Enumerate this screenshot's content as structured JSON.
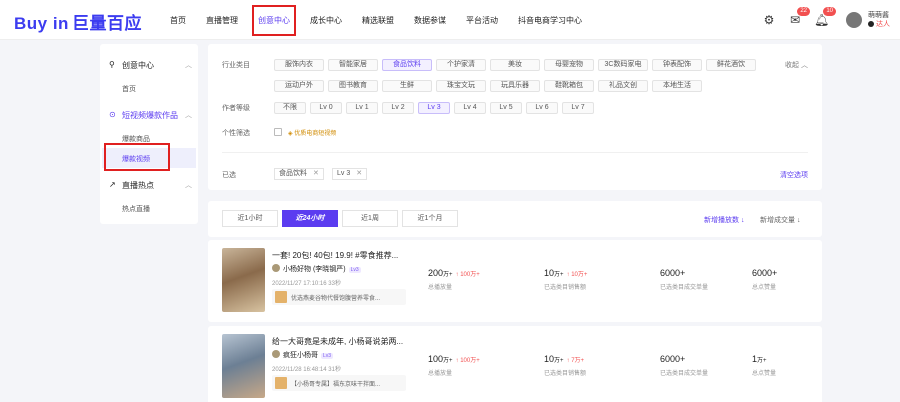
{
  "header": {
    "logo_en": "Buy in",
    "logo_cn": "巨量百应",
    "nav": [
      "首页",
      "直播管理",
      "创意中心",
      "成长中心",
      "精选联盟",
      "数据参谋",
      "平台活动",
      "抖音电商学习中心"
    ],
    "notif_msg_count": "22",
    "notif_bell_count": "10",
    "user_name": "萌萌酱",
    "user_tag": "达人"
  },
  "sidebar": {
    "group1": "创意中心",
    "group1_items": [
      "首页"
    ],
    "group2": "短视频爆款作品",
    "group2_items": [
      "爆款商品",
      "爆款视频"
    ],
    "group3": "直播热点",
    "group3_items": [
      "热点直播"
    ]
  },
  "filter": {
    "industry_label": "行业类目",
    "industry_row1": [
      "服饰内衣",
      "智能家居",
      "食品饮料",
      "个护家清",
      "美妆",
      "母婴宠物",
      "3C数码家电",
      "钟表配饰",
      "鲜花酒饮"
    ],
    "industry_row2": [
      "运动户外",
      "图书教育",
      "生鲜",
      "珠宝文玩",
      "玩具乐器",
      "鞋靴箱包",
      "礼品文创",
      "本地生活"
    ],
    "collapse": "收起",
    "level_label": "作者等级",
    "levels": [
      "不限",
      "Lv 0",
      "Lv 1",
      "Lv 2",
      "Lv 3",
      "Lv 4",
      "Lv 5",
      "Lv 6",
      "Lv 7"
    ],
    "personal_label": "个性筛选",
    "personal_option": "优质电商短视频",
    "selected_label": "已选",
    "selected_tags": [
      "食品饮料",
      "Lv 3"
    ],
    "clear": "清空选项"
  },
  "time_tabs": {
    "tabs": [
      "近1小时",
      "近24小时",
      "近1周",
      "近1个月"
    ],
    "sort1": "新增播放数",
    "sort2": "新增成交量"
  },
  "cards": [
    {
      "title": "一套! 20包! 40包! 19.9! #零食推荐...",
      "author": "小杨好物 (李晓钢严)",
      "level": "Lv3",
      "meta": "2022/11/27 17:10:16  33秒",
      "product": "优选燕麦谷物代餐饱腹营养零食...",
      "stats": [
        {
          "value": "200",
          "unit": "万+",
          "delta": "↑ 100万+",
          "label": "总播放量"
        },
        {
          "value": "10",
          "unit": "万+",
          "delta": "↑ 10万+",
          "label": "已选类目销售额"
        },
        {
          "value": "6000+",
          "unit": "",
          "delta": "",
          "label": "已选类目成交单量"
        },
        {
          "value": "6000+",
          "unit": "",
          "delta": "",
          "label": "总点赞量"
        }
      ]
    },
    {
      "title": "给一大哥竟是未成年, 小杨哥说弟两...",
      "author": "疯狂小杨哥",
      "level": "Lv3",
      "meta": "2022/11/28 16:48:14  31秒",
      "product": "【小杨哥专属】福东京味干拌面...",
      "stats": [
        {
          "value": "100",
          "unit": "万+",
          "delta": "↑ 100万+",
          "label": "总播放量"
        },
        {
          "value": "10",
          "unit": "万+",
          "delta": "↑ 7万+",
          "label": "已选类目销售额"
        },
        {
          "value": "6000+",
          "unit": "",
          "delta": "",
          "label": "已选类目成交单量"
        },
        {
          "value": "1",
          "unit": "万+",
          "delta": "",
          "label": "总点赞量"
        }
      ]
    }
  ]
}
